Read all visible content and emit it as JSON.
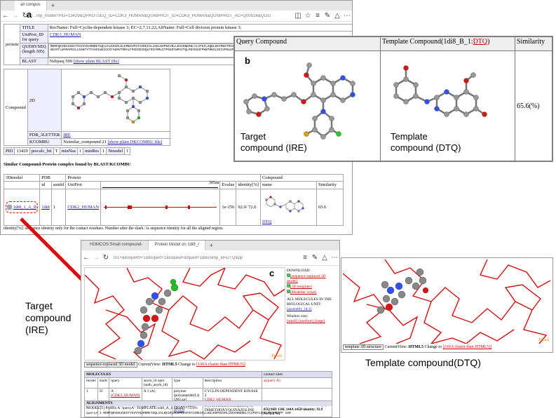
{
  "browser_a": {
    "tab_label": "all compos",
    "new_tab": "+",
    "url": "...mp_model?PID=13429&QPROTSEQ_ID=CDK3_HUMAN&QUNIPROT_ID=CDK3_HUMAN&QUNIPROT_AC=Q00526&QLIG"
  },
  "panel_labels": {
    "a": "a",
    "b": "b",
    "c": "c"
  },
  "protein": {
    "row_label": "protein",
    "title_key": "TITLE",
    "title_val": "RecName: Full=Cyclin-dependent kinase 3; EC=2.7.11.22;AltName: Full=Cell division protein kinase 3;",
    "uniprot_key": "UniProt_ID for query",
    "uniprot_val": "CDK3_HUMAN",
    "queryseq_key": "QUERYSEQ (length 305)",
    "queryseq_val": "MDMFQKVEKIGEGTYGVVYKARNRETGQLVALKKIRLDLEMEGVPSTAIREISLLKELKHPNIVRLLDVVHNERKLYLVFEFLSQDLKKYMDSTPGSELPLHLIKSYLFQLLQGVSFCHSHRVIHRDLKPQNLLINELGAIKLADFGLARAFGVPLRTYTHEVVTLWYRAPEILLGSKFYTTAVDIWSIGCIFAEMVTRRALFPGDSEIDQLFRIFRMLGTPSEDTWPGVTQLPDYKGSFPKWTRKGLEEIVPNLEPEGRDLLMQLLQYDPSQRITAKTALAHPYFSSPEPSPAARQYVLQRFRH",
    "blast_key": "BLAST",
    "blast_val": "Nsbjseq 500",
    "blast_link": "[show plain BLAST file]",
    "compound_label": "Compound",
    "two_d_key": "2D",
    "pdb_key": "PDB_3LETTER",
    "pdb_val": "IRE",
    "kcombu_key": "KCOMBU",
    "kcombu_val": "Nsimilar_compound 21",
    "kcombu_link": "[show plain DKCOMBU file]",
    "pid_cells": [
      "PID",
      "13429",
      "precalc_bit",
      "T",
      "minNsa",
      "1",
      "minRes",
      "1",
      "Nmodel",
      "1"
    ]
  },
  "similar": {
    "heading": "Similar Compound-Protein complex found by BLAST/KCOMBU",
    "headers1": [
      "3Dmodel",
      "PDB",
      "Protein",
      "Compound"
    ],
    "headers2": [
      "id",
      "asmbl",
      "UniProt",
      "",
      "Evalue",
      "identity[%]",
      "name",
      "Similarity"
    ],
    "ruler_end": "305aa",
    "row": {
      "model": "1di8_1_A_B",
      "pdb_id": "1di8",
      "asmbl": "1",
      "uniprot": "CDK2_HUMAN",
      "evalue": "1e-156",
      "identity": "92.9/ 72.6",
      "name": "DTQ",
      "similarity": "65.6"
    },
    "footnote": "identity[%]: sequence identity only for the contact residues. Number after the slash / is sequence identity for all the aligned region."
  },
  "compare": {
    "h_query": "Query Compound",
    "h_template_prefix": "Template Compound(1di8_B_1:",
    "h_template_link": "DTQ",
    "h_template_suffix": ")",
    "h_similarity": "Similarity",
    "similarity_value": "65.6(%)",
    "target_label": "Target\ncompound (IRE)",
    "template_label": "Template\ncompound (DTQ)"
  },
  "browser_c": {
    "tab1": "HOMCOS:Small compound-",
    "tab2": "Protein Model on 1di8_/",
    "new_tab": "+",
    "url": "m1+&iloopert0+1&loopert+1&loqued+&lqued+1&lecomp_id=DTQ&pp",
    "menu": {
      "download": "DOWNLOAD:",
      "item1": "[sequence-replaced 3D model]",
      "item2": "[3D template]",
      "item3": "[Modeller script]",
      "all_molecules": "ALL MOLECULES IN THE BIOLOGICAL UNIT:",
      "assembly": "[assembly_id:1]",
      "window_size": "Window size:",
      "sizes": "[small] [medium] [large]"
    },
    "jsmol": "JSmol",
    "viewer_select": "sequence-replaced 3D model",
    "view_prefix": "CurrentView:",
    "view_html5": "HTML5",
    "view_change": "Change to",
    "view_java": "[JAVA (faster than HTML5)]",
    "molecules_title": "MOLECULES",
    "contact_sites": "contact sites",
    "mol_headers": [
      "model",
      "mark",
      "query",
      "asym_id oper (auth_asym_id)",
      "type",
      "description",
      "a(query A)"
    ],
    "mol_rows": [
      {
        "model": "1",
        "query": "A",
        "query_link": "(CDK3_HUMAN)",
        "asym": "A 1 (A)",
        "type": "polymer (polypeptide(L)) [283 aa]",
        "desc": "CYCLIN-DEPENDENT KINASE 2",
        "desc_link": "CDK2_HUMAN",
        "contact": ""
      },
      {
        "model": "2",
        "query": "K",
        "query_link": "",
        "asym": "B 1 (A)",
        "type": "non-polymer",
        "type_link": "(DTQ)",
        "desc": "4-[3-HYDROXYANILINO]-6,7-DIMETHOXYQUINAZOLINE",
        "contact": "10I 18V 31A 33K 80F 81E 82F 83L 84S(H) 85Q 86D 134L 144A 145D identity: 92.9 %/72.6 %)"
      }
    ],
    "alignments_title": "ALIGNMENTS",
    "alignment_line": "MODEL[1] Protein A \"queryA\" TEMPLATE:1di8_A_1 identity=72.6%",
    "seq_query_label": "queryA",
    "seq_query": "1 MDMFQKVEKIGEGTYGVVYKARNRETGQLVALKKIRLDLEMEGVPSTAIREISLLKELKHPNIVRLLDVVHNERKLYLVFEFLSQDLKKYMDSTP 100",
    "seq_marks": "   :*  ****************** * *.*************.*.:********.****************.*:*.*****:**:*****"
  },
  "template_view": {
    "select": "template 3D structure",
    "jsmol": "JSmol",
    "view_prefix": "CurrentView:",
    "view_html5": "HTML5",
    "view_change": "Change to",
    "view_java": "[JAVA (faster than HTML5)]"
  },
  "annotations": {
    "target_left": "Target\ncompound\n(IRE)",
    "template_right": "Template compound(DTQ)"
  }
}
